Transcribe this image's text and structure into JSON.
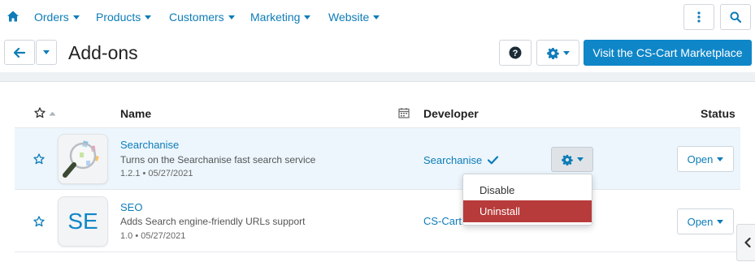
{
  "nav": {
    "home_icon": "home-icon",
    "items": [
      {
        "label": "Orders"
      },
      {
        "label": "Products"
      },
      {
        "label": "Customers"
      },
      {
        "label": "Marketing"
      },
      {
        "label": "Website"
      }
    ],
    "right_icons": [
      "more-vertical-icon",
      "search-icon"
    ]
  },
  "toolbar": {
    "back_icon": "arrow-left-icon",
    "title": "Add-ons",
    "help_icon": "question-circle-icon",
    "settings_icon": "gear-icon",
    "marketplace_label": "Visit the CS-Cart Marketplace"
  },
  "table": {
    "headers": {
      "name": "Name",
      "developer": "Developer",
      "status": "Status"
    },
    "rows": [
      {
        "name": "Searchanise",
        "description": "Turns on the Searchanise fast search service",
        "meta": "1.2.1 • 05/27/2021",
        "developer": "Searchanise",
        "verified_icon": "checkmark-icon",
        "status": "Open"
      },
      {
        "thumb_text": "SE",
        "name": "SEO",
        "description": "Adds Search engine-friendly URLs support",
        "meta": "1.0 • 05/27/2021",
        "developer": "CS-Cart",
        "status": "Open"
      }
    ]
  },
  "dropdown": {
    "items": [
      {
        "label": "Disable"
      },
      {
        "label": "Uninstall"
      }
    ]
  },
  "colors": {
    "accent": "#0f86c8",
    "link": "#0e7cb8",
    "danger": "#b83b3b",
    "row_highlight": "#ecf6fc"
  }
}
